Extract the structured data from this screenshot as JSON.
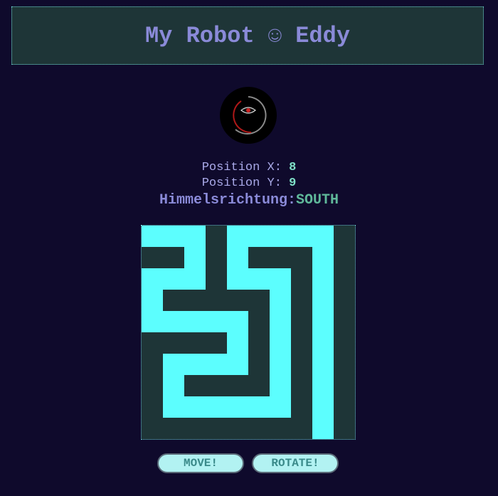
{
  "header": {
    "title": "My Robot ☺ Eddy"
  },
  "robot": {
    "avatar_icon": "eye-icon",
    "position_x_label": "Position X:",
    "position_x": "8",
    "position_y_label": "Position Y:",
    "position_y": "9",
    "direction_label": "Himmelsrichtung:",
    "direction": "SOUTH"
  },
  "maze": {
    "rows": 10,
    "cols": 10,
    "wall_color": "#1e3537",
    "path_color": "#5cfefe",
    "grid": [
      "PPPWPPPPPW",
      "WWPWPWWWPW",
      "PPPWPPPWPW",
      "PWWWWWPWPW",
      "PPPPPWPWPW",
      "WWWWPWPWPW",
      "WPPPPWPWPW",
      "WPWWWWPWPW",
      "WPPPPPPWPW",
      "WWWWWWWWPW"
    ]
  },
  "controls": {
    "move_label": "MOVE!",
    "rotate_label": "ROTATE!"
  }
}
